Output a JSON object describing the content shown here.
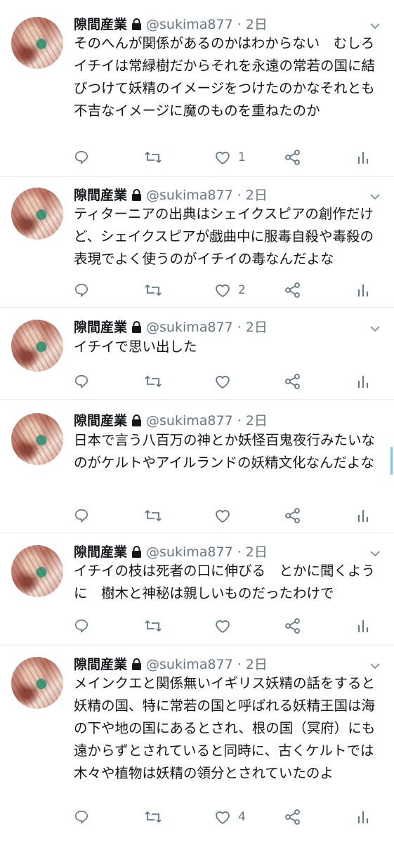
{
  "tweets": [
    {
      "name": "隙間産業",
      "handle": "@sukima877",
      "dot": "·",
      "time": "2日",
      "text": "そのへんが関係があるのかはわからない　むしろイチイは常緑樹だからそれを永遠の常若の国に結びつけて妖精のイメージをつけたのかなそれとも不吉なイメージに魔のものを重ねたのか",
      "likes": "1"
    },
    {
      "name": "隙間産業",
      "handle": "@sukima877",
      "dot": "·",
      "time": "2日",
      "text": "ティターニアの出典はシェイクスピアの創作だけど、シェイクスピアが戯曲中に服毒自殺や毒殺の表現でよく使うのがイチイの毒なんだよな",
      "likes": "2"
    },
    {
      "name": "隙間産業",
      "handle": "@sukima877",
      "dot": "·",
      "time": "2日",
      "text": "イチイで思い出した",
      "likes": ""
    },
    {
      "name": "隙間産業",
      "handle": "@sukima877",
      "dot": "·",
      "time": "2日",
      "text": "日本で言う八百万の神とか妖怪百鬼夜行みたいなのがケルトやアイルランドの妖精文化なんだよな",
      "likes": ""
    },
    {
      "name": "隙間産業",
      "handle": "@sukima877",
      "dot": "·",
      "time": "2日",
      "text": "イチイの枝は死者の口に伸びる　とかに聞くように　樹木と神秘は親しいものだったわけで",
      "likes": ""
    },
    {
      "name": "隙間産業",
      "handle": "@sukima877",
      "dot": "·",
      "time": "2日",
      "text": "メインクエと関係無いイギリス妖精の話をすると妖精の国、特に常若の国と呼ばれる妖精王国は海の下や地の国にあるとされ、根の国（冥府）にも遠からずとされていると同時に、古くケルトでは木々や植物は妖精の領分とされていたのよ",
      "likes": "4"
    }
  ]
}
